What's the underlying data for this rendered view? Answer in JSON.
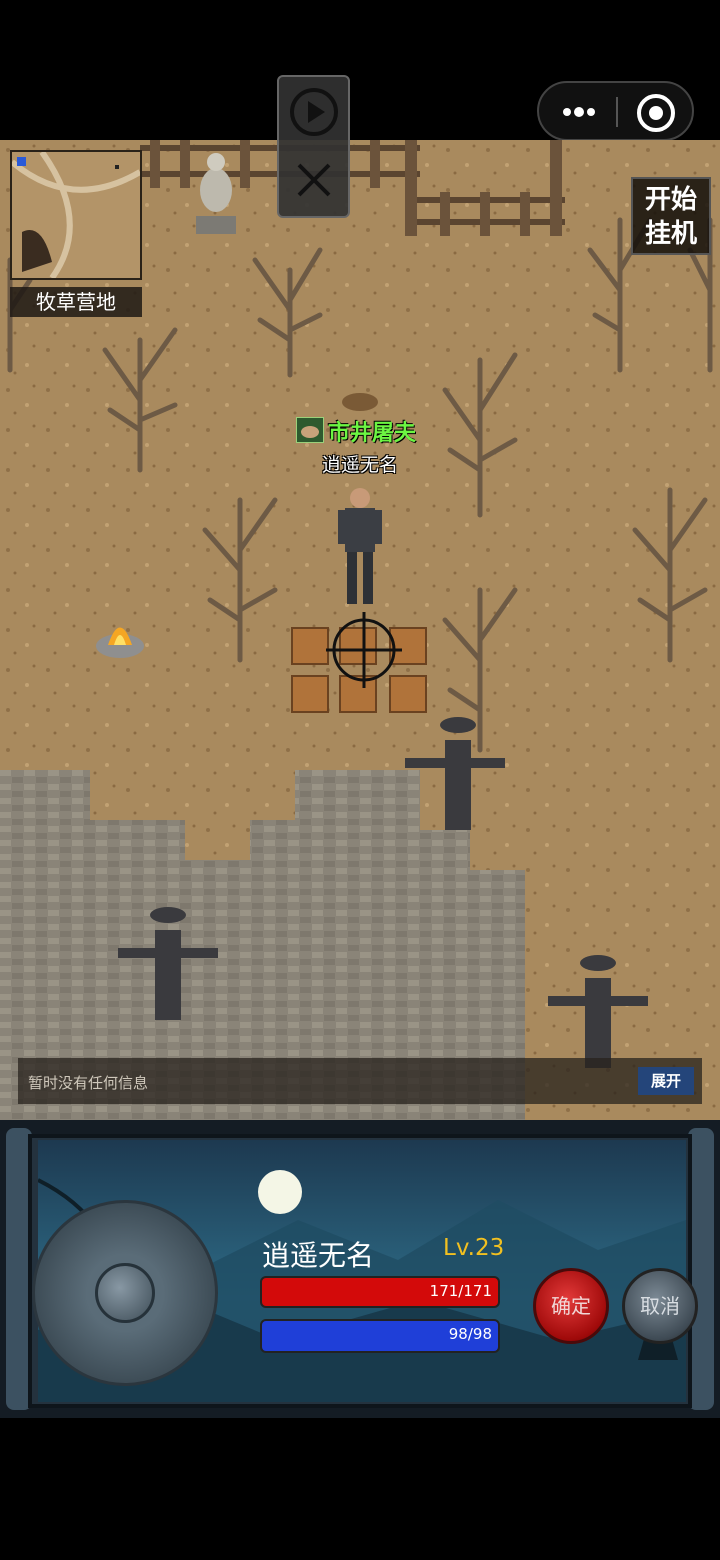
{
  "map": {
    "location_name": "牧草营地",
    "auto_button": {
      "line1": "开始",
      "line2": "挂机"
    }
  },
  "npc": {
    "name": "市井屠夫"
  },
  "player": {
    "name": "逍遥无名"
  },
  "message_bar": {
    "text": "暂时没有任何信息",
    "expand_label": "展开"
  },
  "status": {
    "name": "逍遥无名",
    "level": "Lv.23",
    "hp": "171/171",
    "mp": "98/98",
    "hp_fraction": 1.0,
    "mp_fraction": 1.0
  },
  "actions": {
    "confirm_label": "确定",
    "cancel_label": "取消"
  },
  "colors": {
    "hp": "#d30a0a",
    "mp": "#1f3fd8",
    "npc_name": "#6cf542",
    "level": "#f2c020"
  }
}
